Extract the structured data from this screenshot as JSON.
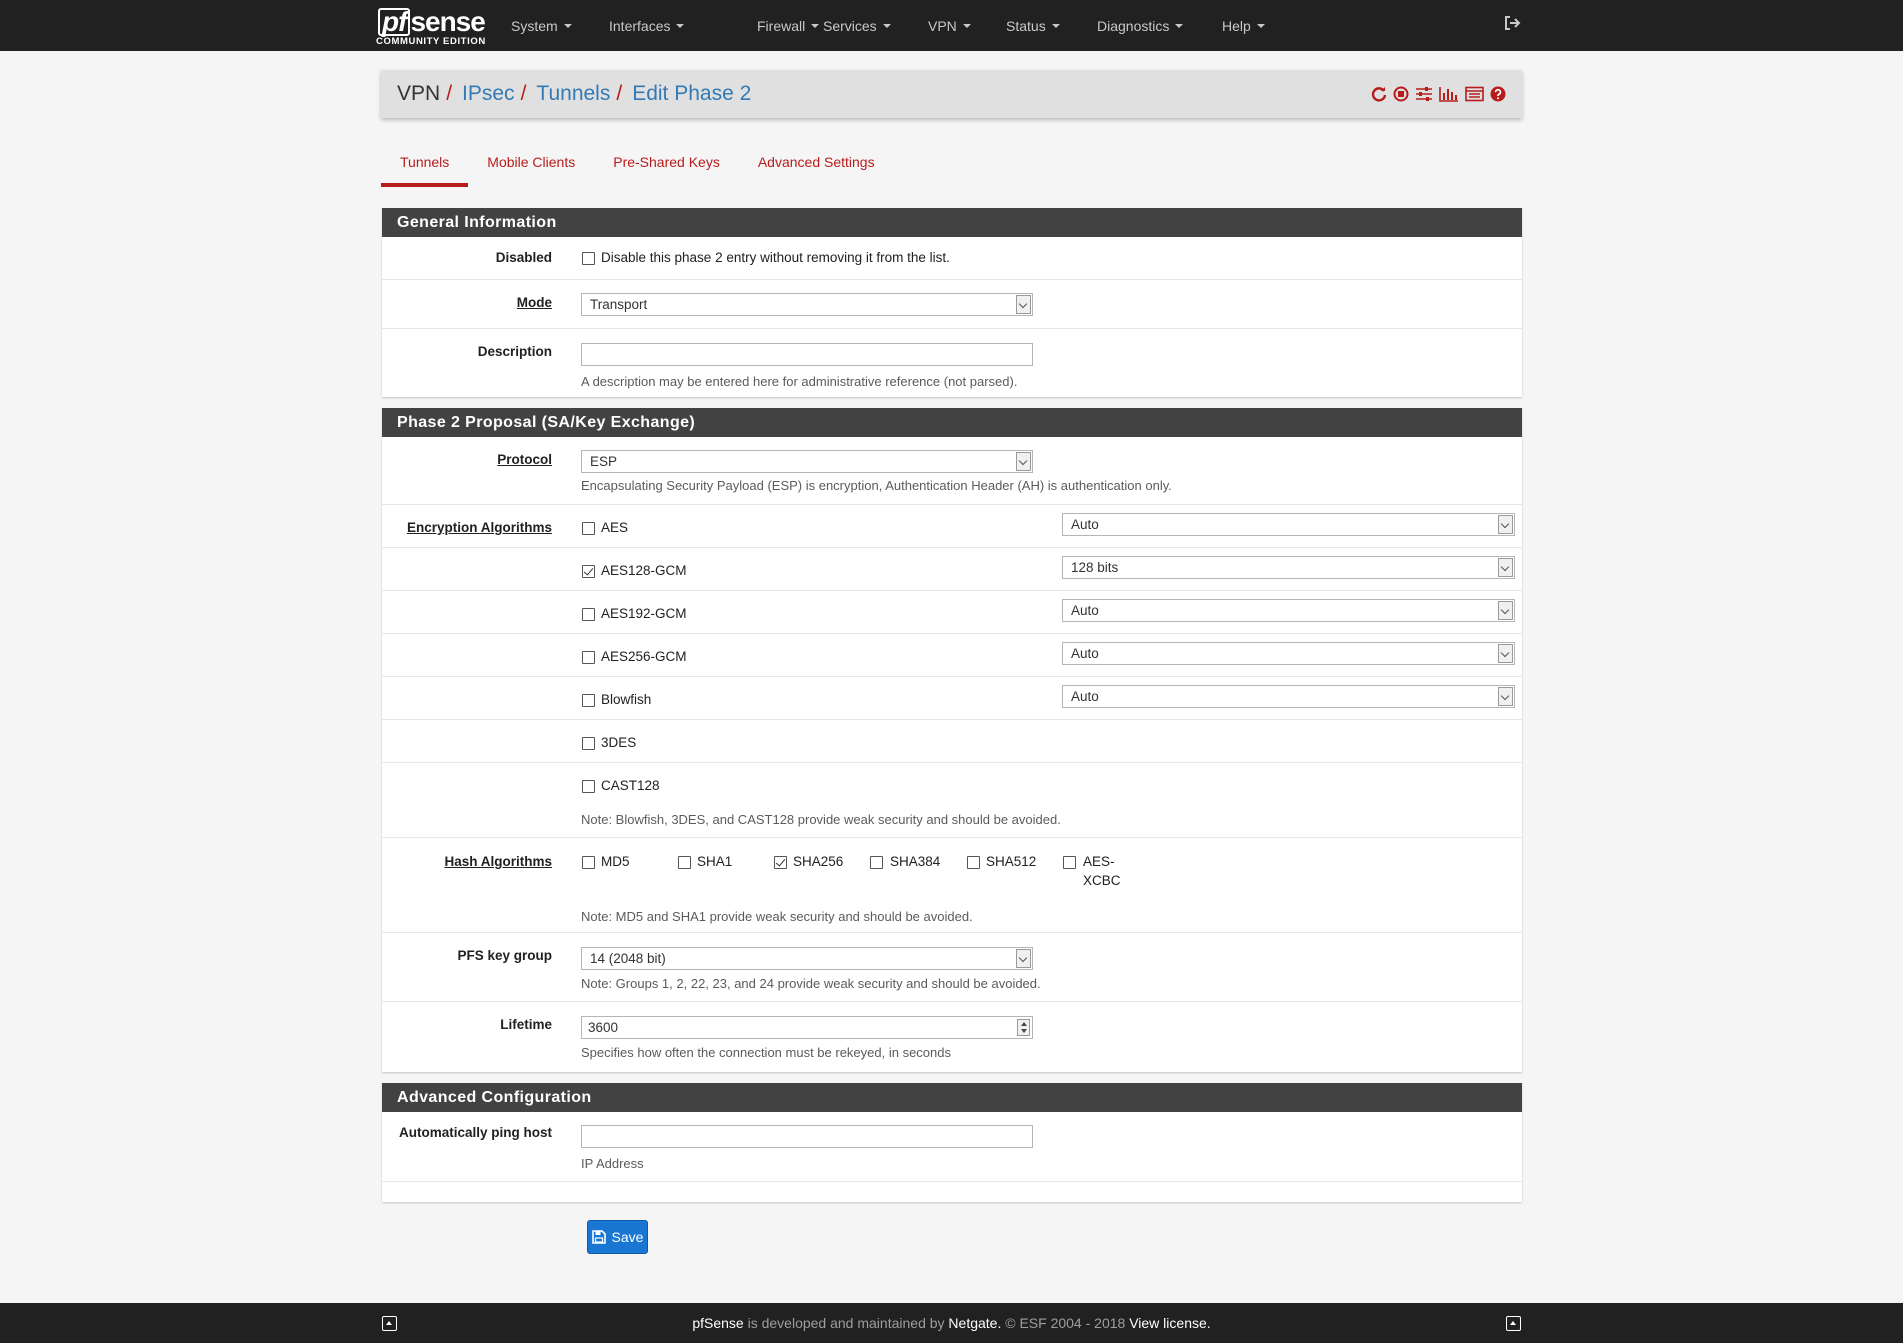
{
  "navbar": {
    "brand": {
      "logo_pf": "pf",
      "logo_sense": "sense",
      "edition": "COMMUNITY EDITION"
    },
    "menu": [
      "System",
      "Interfaces",
      "Firewall",
      "Services",
      "VPN",
      "Status",
      "Diagnostics",
      "Help"
    ],
    "logout_icon": "sign-out-icon"
  },
  "breadcrumb": {
    "items": [
      "VPN",
      "IPsec",
      "Tunnels",
      "Edit Phase 2"
    ],
    "separator": "/",
    "icons": [
      "restart-service-icon",
      "stop-service-icon",
      "settings-sliders-icon",
      "bar-chart-icon",
      "log-list-icon",
      "help-icon"
    ]
  },
  "tabs": [
    "Tunnels",
    "Mobile Clients",
    "Pre-Shared Keys",
    "Advanced Settings"
  ],
  "active_tab": "Tunnels",
  "general": {
    "heading": "General Information",
    "disabled": {
      "label": "Disabled",
      "checkbox_label": "Disable this phase 2 entry without removing it from the list.",
      "checked": false
    },
    "mode": {
      "label": "Mode",
      "value": "Transport"
    },
    "description": {
      "label": "Description",
      "value": "",
      "help": "A description may be entered here for administrative reference (not parsed)."
    }
  },
  "phase2": {
    "heading": "Phase 2 Proposal (SA/Key Exchange)",
    "protocol": {
      "label": "Protocol",
      "value": "ESP",
      "help": "Encapsulating Security Payload (ESP) is encryption, Authentication Header (AH) is authentication only."
    },
    "encryption": {
      "label": "Encryption Algorithms",
      "algorithms": [
        {
          "name": "AES",
          "checked": false,
          "keylen": "Auto"
        },
        {
          "name": "AES128-GCM",
          "checked": true,
          "keylen": "128 bits"
        },
        {
          "name": "AES192-GCM",
          "checked": false,
          "keylen": "Auto"
        },
        {
          "name": "AES256-GCM",
          "checked": false,
          "keylen": "Auto"
        },
        {
          "name": "Blowfish",
          "checked": false,
          "keylen": "Auto"
        },
        {
          "name": "3DES",
          "checked": false,
          "keylen": null
        },
        {
          "name": "CAST128",
          "checked": false,
          "keylen": null
        }
      ],
      "note": "Note: Blowfish, 3DES, and CAST128 provide weak security and should be avoided."
    },
    "hash": {
      "label": "Hash Algorithms",
      "algorithms": [
        {
          "name": "MD5",
          "checked": false
        },
        {
          "name": "SHA1",
          "checked": false
        },
        {
          "name": "SHA256",
          "checked": true
        },
        {
          "name": "SHA384",
          "checked": false
        },
        {
          "name": "SHA512",
          "checked": false
        },
        {
          "name_line1": "AES-",
          "name_line2": "XCBC",
          "checked": false
        }
      ],
      "note": "Note: MD5 and SHA1 provide weak security and should be avoided."
    },
    "pfs": {
      "label": "PFS key group",
      "value": "14 (2048 bit)",
      "note": "Note: Groups 1, 2, 22, 23, and 24 provide weak security and should be avoided."
    },
    "lifetime": {
      "label": "Lifetime",
      "value": "3600",
      "help": "Specifies how often the connection must be rekeyed, in seconds"
    }
  },
  "advanced": {
    "heading": "Advanced Configuration",
    "ping_host": {
      "label": "Automatically ping host",
      "value": "",
      "help": "IP Address"
    }
  },
  "save_button": {
    "label": "Save",
    "icon": "save-icon"
  },
  "footer": {
    "brand": "pfSense",
    "text1": " is developed and maintained by ",
    "company": "Netgate.",
    "text2": " © ESF 2004 - 2018 ",
    "license": "View license.",
    "left_icon": "scroll-top-icon",
    "right_icon": "scroll-top-icon"
  },
  "colors": {
    "navbar": "#212121",
    "accent_red": "#b71c1c",
    "link_blue": "#337ab7",
    "panel_heading": "#424242",
    "primary_button": "#1976d2"
  }
}
